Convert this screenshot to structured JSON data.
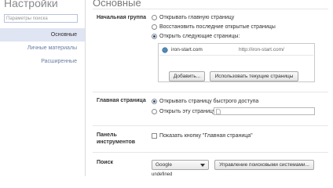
{
  "sidebar": {
    "title": "Настройки",
    "search_placeholder": "Параметры поиска",
    "items": [
      {
        "label": "Основные"
      },
      {
        "label": "Личные материалы"
      },
      {
        "label": "Расширенные"
      }
    ]
  },
  "main": {
    "title": "Основные",
    "startup": {
      "label": "Начальная группа",
      "options": [
        {
          "label": "Открывать главную страницу",
          "checked": false
        },
        {
          "label": "Восстановить последние открытые страницы",
          "checked": false
        },
        {
          "label": "Открыть следующие страницы:",
          "checked": true
        }
      ],
      "pages": [
        {
          "name": "iron-start.com",
          "url": "http://iron-start.com/"
        }
      ],
      "add_button": "Добавить...",
      "use_current_button": "Использовать текущие страницы"
    },
    "homepage": {
      "label": "Главная страница",
      "options": [
        {
          "label": "Открывать страницу быстрого доступа",
          "checked": true
        },
        {
          "label": "Открыть эту страницу:",
          "checked": false
        }
      ],
      "url_value": ""
    },
    "toolbar": {
      "label_line1": "Панель",
      "label_line2": "инструментов",
      "home_button_checkbox": "Показать кнопку \"Главная страница\"",
      "checked": false
    },
    "search": {
      "label": "Поиск",
      "engine": "Google",
      "manage_button": "Управление поисковыми системами...",
      "footer_text": "undefined"
    }
  }
}
